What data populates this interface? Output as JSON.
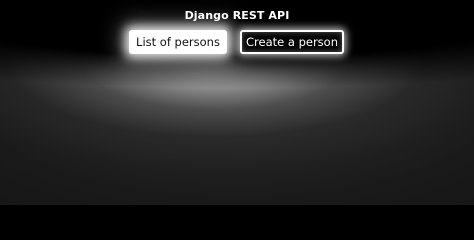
{
  "header": {
    "title": "Django REST API"
  },
  "nav": {
    "buttons": [
      {
        "label": "List of persons",
        "active": true
      },
      {
        "label": "Create a person",
        "active": false
      }
    ]
  },
  "colors": {
    "background": "#000000",
    "button_active_bg": "#ffffff",
    "button_active_text": "#111111",
    "button_outline": "#ffffff",
    "button_outline_text": "#ffffff"
  }
}
